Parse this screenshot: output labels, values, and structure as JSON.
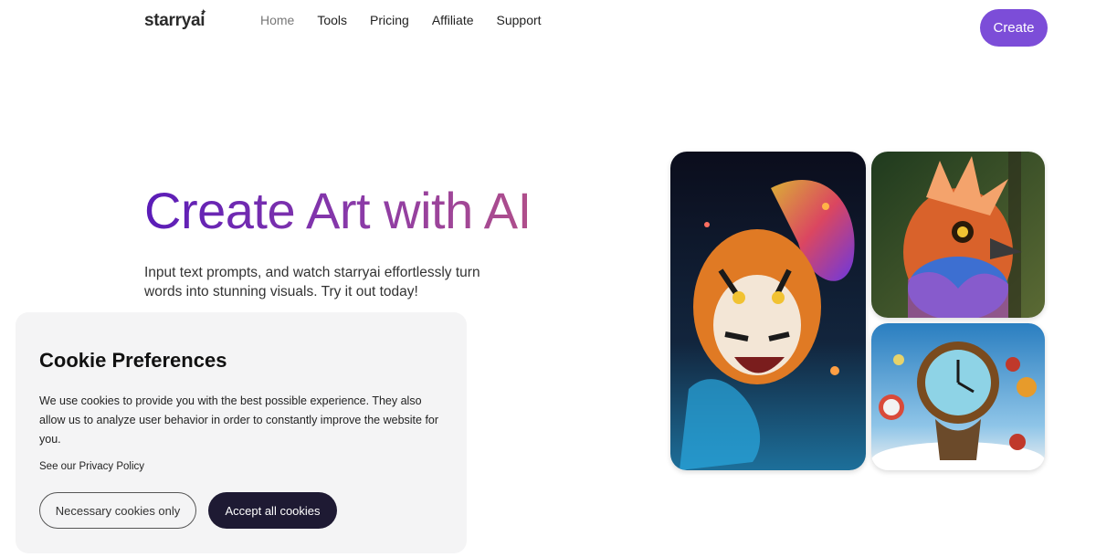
{
  "nav": {
    "logo": "starryai",
    "logo_mark": "✦",
    "links": [
      "Home",
      "Tools",
      "Pricing",
      "Affiliate",
      "Support"
    ],
    "active_link": "Home",
    "create_label": "Create"
  },
  "hero": {
    "title": "Create Art with AI",
    "subtitle": "Input text prompts, and watch starryai effortlessly turn words into stunning visuals. Try it out today!"
  },
  "gallery": {
    "images": [
      "tiger-artwork-image",
      "bird-artwork-image",
      "clock-artwork-image"
    ]
  },
  "cookie": {
    "title": "Cookie Preferences",
    "text": "We use cookies to provide you with the best possible experience. They also allow us to analyze user behavior in order to constantly improve the website for you.",
    "link": "See our Privacy Policy",
    "necessary_label": "Necessary cookies only",
    "accept_label": "Accept all cookies"
  },
  "colors": {
    "accent": "#7c4dd8",
    "dark_button": "#1e1a33",
    "title_gradient_start": "#5a1cb8",
    "title_gradient_end": "#b04f8a"
  }
}
